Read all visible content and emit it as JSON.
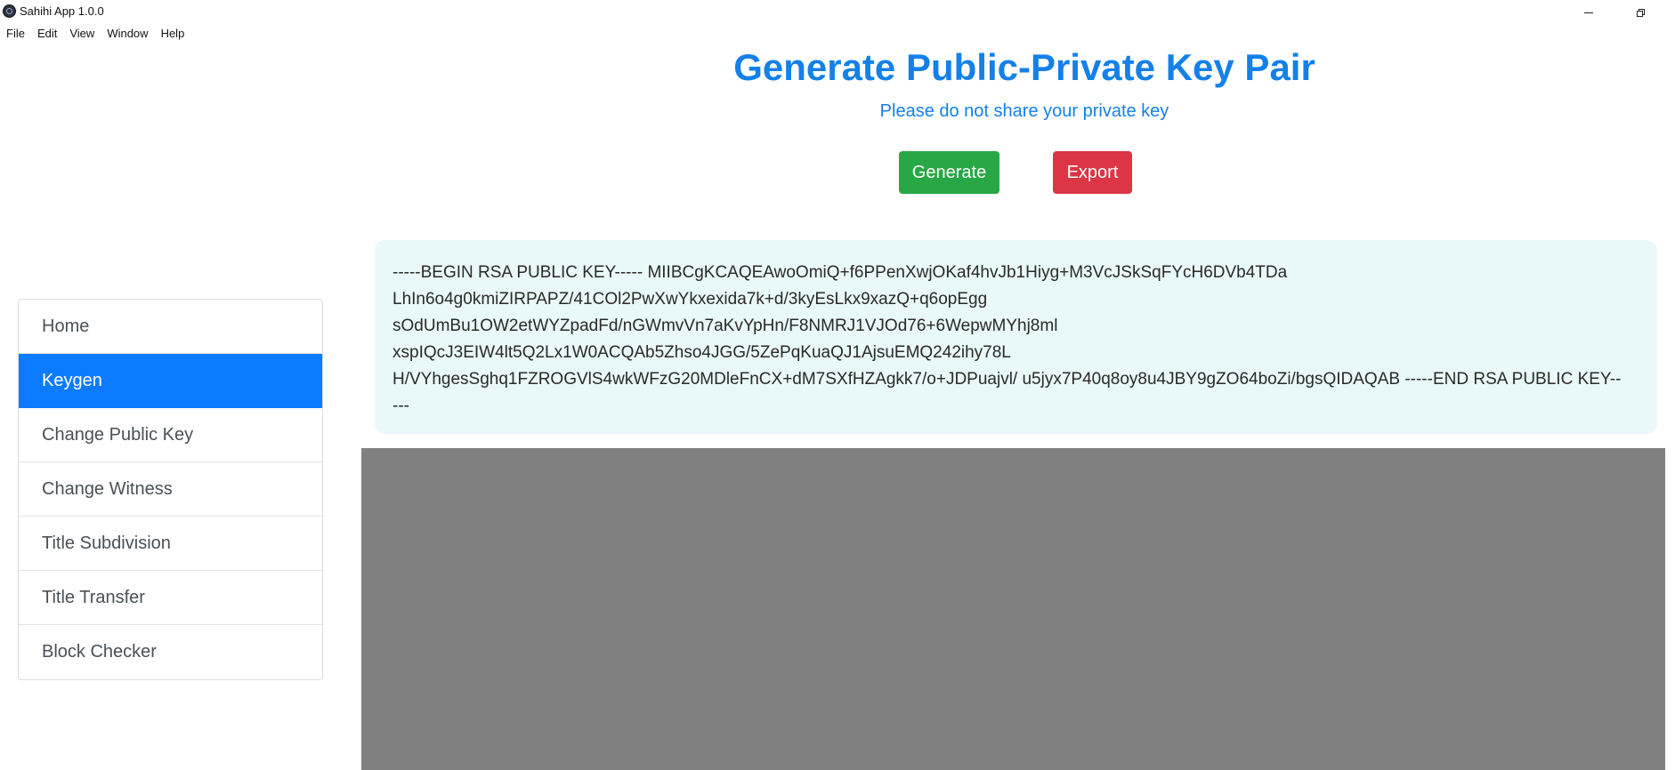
{
  "window": {
    "title": "Sahihi App 1.0.0",
    "minimize_icon": "minimize-icon",
    "restore_icon": "restore-icon"
  },
  "menu": [
    "File",
    "Edit",
    "View",
    "Window",
    "Help"
  ],
  "sidebar": {
    "items": [
      {
        "label": "Home",
        "active": false
      },
      {
        "label": "Keygen",
        "active": true
      },
      {
        "label": "Change Public Key",
        "active": false
      },
      {
        "label": "Change Witness",
        "active": false
      },
      {
        "label": "Title Subdivision",
        "active": false
      },
      {
        "label": "Title Transfer",
        "active": false
      },
      {
        "label": "Block Checker",
        "active": false
      }
    ]
  },
  "header": {
    "title": "Generate Public-Private Key Pair",
    "subtitle": "Please do not share your private key"
  },
  "actions": {
    "generate_label": "Generate",
    "export_label": "Export"
  },
  "key_output": {
    "lines": [
      "-----BEGIN RSA PUBLIC KEY----- MIIBCgKCAQEAwoOmiQ+f6PPenXwjOKaf4hvJb1Hiyg+M3VcJSkSqFYcH6DVb4TDa",
      "LhIn6o4g0kmiZIRPAPZ/41COl2PwXwYkxexida7k+d/3kyEsLkx9xazQ+q6opEgg",
      "sOdUmBu1OW2etWYZpadFd/nGWmvVn7aKvYpHn/F8NMRJ1VJOd76+6WepwMYhj8ml",
      "xspIQcJ3EIW4lt5Q2Lx1W0ACQAb5Zhso4JGG/5ZePqKuaQJ1AjsuEMQ242ihy78L",
      "H/VYhgesSghq1FZROGVlS4wkWFzG20MDleFnCX+dM7SXfHZAgkk7/o+JDPuajvl/ u5jyx7P40q8oy8u4JBY9gZO64boZi/bgsQIDAQAB -----END RSA PUBLIC KEY--",
      "---"
    ]
  },
  "colors": {
    "primary": "#0d7bff",
    "title_blue": "#1480e8",
    "success": "#28a745",
    "danger": "#dc3545",
    "key_bg": "#e9f8f8",
    "panel_grey": "#808080"
  }
}
